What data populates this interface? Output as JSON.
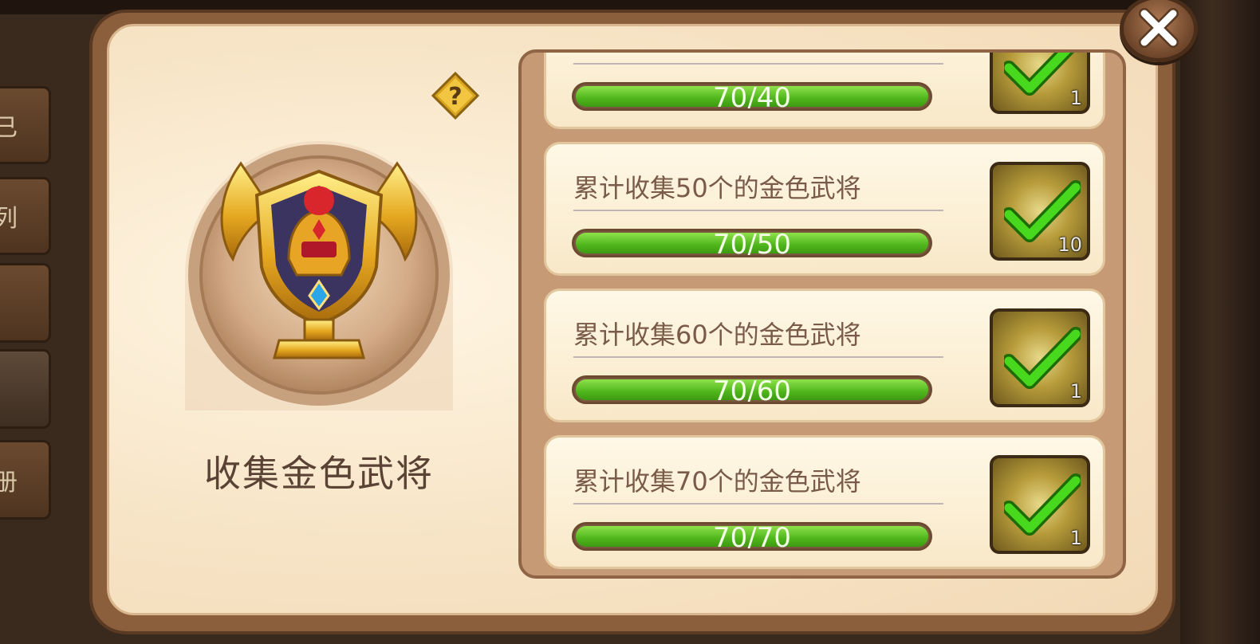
{
  "side_tabs": [
    {
      "label": "已"
    },
    {
      "label": "列"
    },
    {
      "label": ""
    },
    {
      "label": ""
    },
    {
      "label": "册"
    }
  ],
  "collection": {
    "title": "收集金色武将",
    "help_icon": "question-icon",
    "emblem_icon": "golden-helmet-trophy"
  },
  "tasks": [
    {
      "label": "",
      "progress_text": "70/40",
      "progress": 1.0,
      "reward_count": "1",
      "claimed": true
    },
    {
      "label": "累计收集50个的金色武将",
      "progress_text": "70/50",
      "progress": 1.0,
      "reward_count": "10",
      "claimed": true
    },
    {
      "label": "累计收集60个的金色武将",
      "progress_text": "70/60",
      "progress": 1.0,
      "reward_count": "1",
      "claimed": true
    },
    {
      "label": "累计收集70个的金色武将",
      "progress_text": "70/70",
      "progress": 1.0,
      "reward_count": "1",
      "claimed": true
    }
  ],
  "close_icon": "close-icon",
  "colors": {
    "progress_green": "#4fb51c",
    "panel_brown": "#8b5e3c",
    "check_green": "#3ccf1a"
  }
}
